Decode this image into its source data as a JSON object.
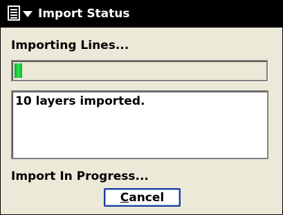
{
  "window": {
    "title": "Import Status",
    "menu_icon": "document-menu-icon"
  },
  "status": {
    "heading": "Importing Lines...",
    "progress_percent": 3,
    "log_text": "10 layers imported.",
    "footer": "Import In Progress..."
  },
  "buttons": {
    "cancel_accel": "C",
    "cancel_rest": "ancel"
  },
  "colors": {
    "titlebar": "#000000",
    "background": "#ece9d8",
    "progress_fill": "#2ee34d",
    "button_border": "#1a3e9c"
  }
}
